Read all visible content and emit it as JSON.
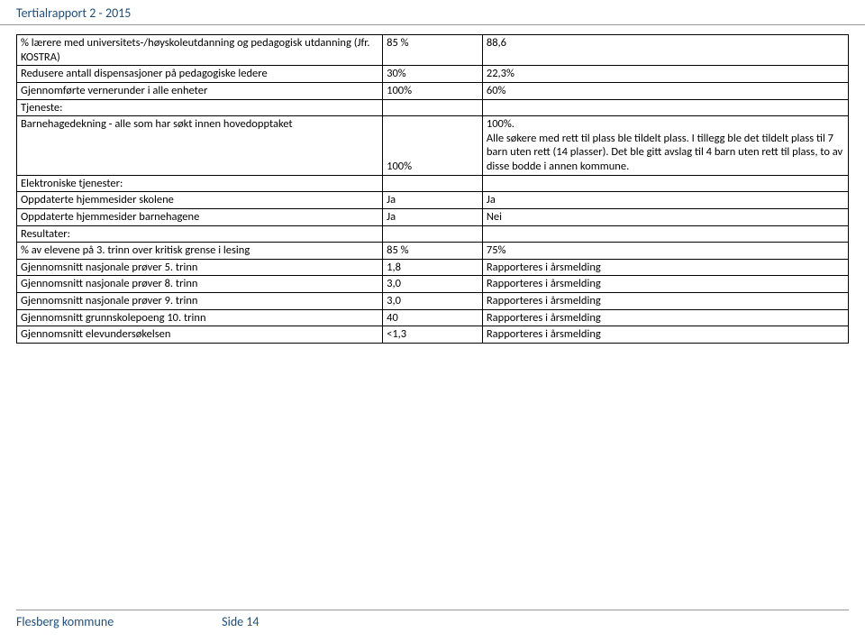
{
  "header": "Tertialrapport 2 - 2015",
  "footer": {
    "left": "Flesberg kommune",
    "right": "Side 14"
  },
  "rows": [
    {
      "a": "% lærere med universitets-/høyskoleutdanning og pedagogisk utdanning (Jfr. KOSTRA)",
      "b": "85 %",
      "c": "88,6"
    },
    {
      "a": "Redusere antall dispensasjoner på pedagogiske ledere",
      "b": "30%",
      "c": "22,3%"
    },
    {
      "a": "Gjennomførte vernerunder i alle enheter",
      "b": "100%",
      "c": "60%"
    },
    {
      "a": "Tjeneste:",
      "b": "",
      "c": ""
    },
    {
      "a": "Barnehagedekning - alle som har søkt innen hovedopptaket",
      "b": "100%",
      "c": "100%.\nAlle søkere med rett til plass ble tildelt plass. I tillegg ble det tildelt plass til 7 barn uten rett (14 plasser). Det ble gitt avslag til 4 barn uten rett til plass, to av disse bodde i annen kommune."
    },
    {
      "a": "Elektroniske tjenester:",
      "b": "",
      "c": ""
    },
    {
      "a": "Oppdaterte hjemmesider skolene",
      "b": "Ja",
      "c": "Ja"
    },
    {
      "a": "Oppdaterte hjemmesider barnehagene",
      "b": "Ja",
      "c": "Nei"
    },
    {
      "a": "Resultater:",
      "b": "",
      "c": ""
    },
    {
      "a": "% av elevene på 3. trinn over kritisk grense i lesing",
      "b": "85 %",
      "c": "75%"
    },
    {
      "a": "Gjennomsnitt nasjonale prøver 5. trinn",
      "b": "1,8",
      "c": "Rapporteres i årsmelding"
    },
    {
      "a": "Gjennomsnitt nasjonale prøver 8. trinn",
      "b": "3,0",
      "c": "Rapporteres i årsmelding"
    },
    {
      "a": "Gjennomsnitt nasjonale prøver 9. trinn",
      "b": "3,0",
      "c": "Rapporteres i årsmelding"
    },
    {
      "a": "Gjennomsnitt grunnskolepoeng 10. trinn",
      "b": "40",
      "c": "Rapporteres i årsmelding"
    },
    {
      "a": "Gjennomsnitt elevundersøkelsen",
      "b": "<1,3",
      "c": "Rapporteres i årsmelding"
    }
  ]
}
